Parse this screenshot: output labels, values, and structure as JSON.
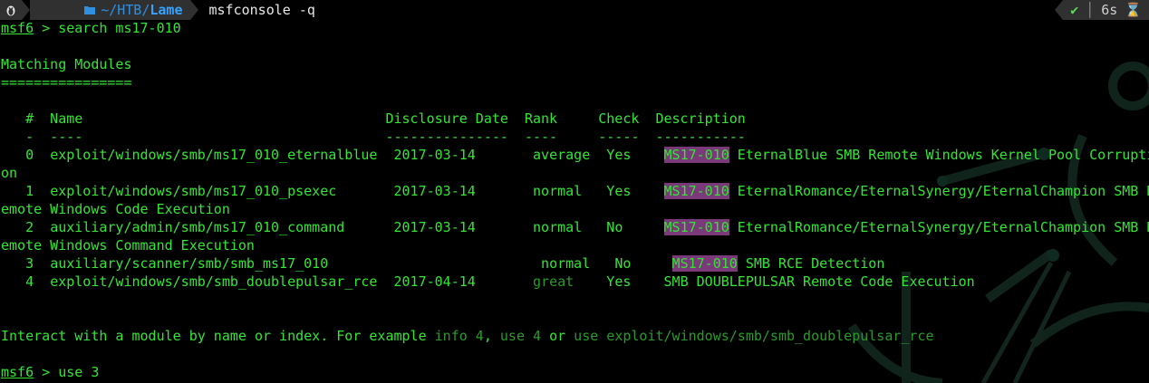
{
  "prompt_bar": {
    "os_icon": "tux-icon",
    "folder_icon": "folder-icon",
    "dir_prefix": "~/HTB/",
    "dir_bold": "Lame",
    "command": "msfconsole -q",
    "status_ok": "✔",
    "elapsed": "6s",
    "timer_icon": "hourglass-icon"
  },
  "console": {
    "prompt": "msf6",
    "search_cmd": " > search ms17-010",
    "matching_title": "Matching Modules",
    "matching_rule": "================",
    "table": {
      "header": "   #  Name                                     Disclosure Date  Rank     Check  Description",
      "rule": "   -  ----                                     ---------------  ----     -----  -----------",
      "rows": [
        {
          "index": "0",
          "name": "exploit/windows/smb/ms17_010_eternalblue",
          "date": "2017-03-14",
          "rank": "average",
          "check": "Yes",
          "desc_tag": "MS17-010",
          "desc_rest": " EternalBlue SMB Remote Windows Kernel Pool Corrupti",
          "wrap": "on"
        },
        {
          "index": "1",
          "name": "exploit/windows/smb/ms17_010_psexec",
          "date": "2017-03-14",
          "rank": "normal",
          "check": "Yes",
          "desc_tag": "MS17-010",
          "desc_rest": " EternalRomance/EternalSynergy/EternalChampion SMB R",
          "wrap": "emote Windows Code Execution"
        },
        {
          "index": "2",
          "name": "auxiliary/admin/smb/ms17_010_command",
          "date": "2017-03-14",
          "rank": "normal",
          "check": "No",
          "desc_tag": "MS17-010",
          "desc_rest": " EternalRomance/EternalSynergy/EternalChampion SMB R",
          "wrap": "emote Windows Command Execution"
        },
        {
          "index": "3",
          "name": "auxiliary/scanner/smb/smb_ms17_010",
          "date": "",
          "rank": "normal",
          "check": "No",
          "desc_tag": "MS17-010",
          "desc_rest": " SMB RCE Detection",
          "wrap": ""
        },
        {
          "index": "4",
          "name": "exploit/windows/smb/smb_doublepulsar_rce",
          "date": "2017-04-14",
          "rank": "great",
          "check": "Yes",
          "desc_tag": "",
          "desc_rest": "SMB DOUBLEPULSAR Remote Code Execution",
          "wrap": ""
        }
      ]
    },
    "interact": {
      "lead": "Interact with a module by name or index. For example ",
      "ex1": "info 4",
      "sep1": ", ",
      "ex2": "use 4",
      "sep2": " or ",
      "ex3": "use exploit/windows/smb/smb_doublepulsar_rce"
    },
    "use_cmd": " > use 3"
  },
  "colors": {
    "text": "#34e534",
    "highlight": "#7a3a7a",
    "dim": "#2b9a2b",
    "bar": "#303030",
    "dir": "#35a3ff"
  }
}
